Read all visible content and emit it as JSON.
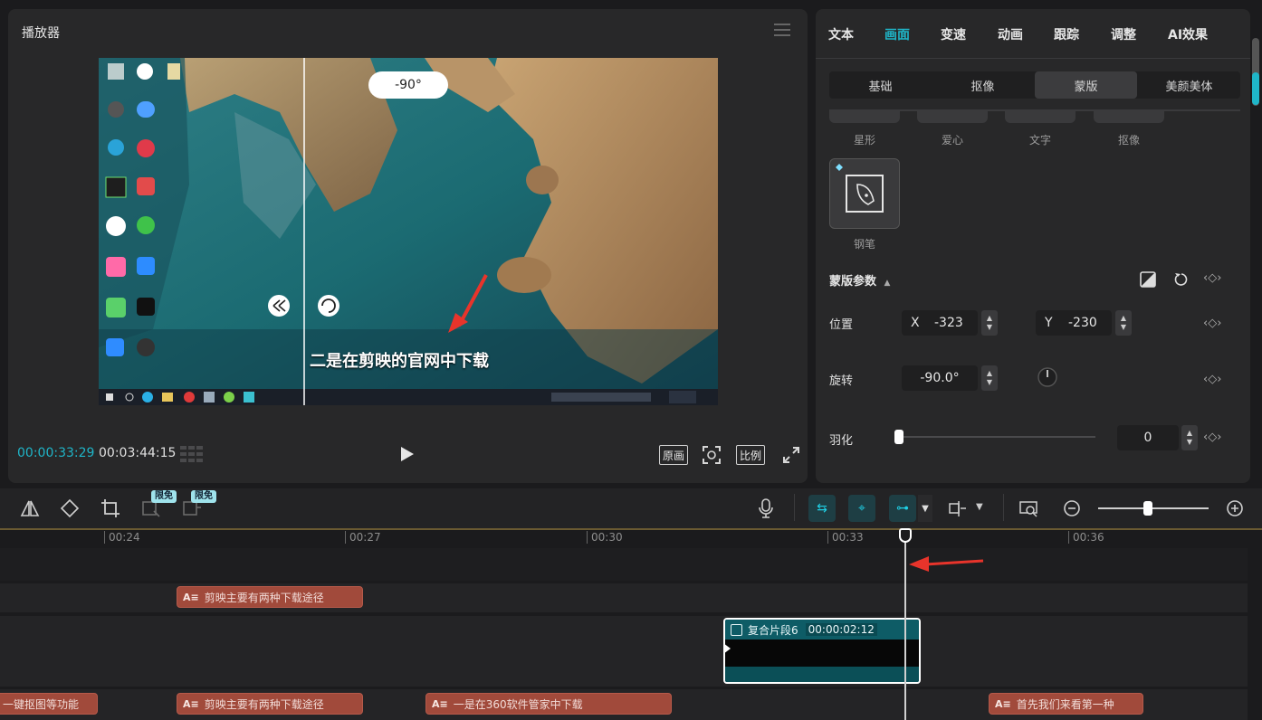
{
  "player": {
    "title": "播放器",
    "rotation_bubble": "-90°",
    "subtitle": "二是在剪映的官网中下载",
    "time_current": "00:00:33:29",
    "time_total": "00:03:44:15",
    "btn_original": "原画",
    "btn_ratio": "比例"
  },
  "props": {
    "tabs": [
      "文本",
      "画面",
      "变速",
      "动画",
      "跟踪",
      "调整",
      "AI效果"
    ],
    "active_tab": "画面",
    "subtabs": [
      "基础",
      "抠像",
      "蒙版",
      "美颜美体"
    ],
    "active_subtab": "蒙版",
    "shapes": [
      "星形",
      "爱心",
      "文字",
      "抠像"
    ],
    "pen_label": "钢笔",
    "mask_params_label": "蒙版参数",
    "position_label": "位置",
    "x_label": "X",
    "x_value": "-323",
    "y_label": "Y",
    "y_value": "-230",
    "rotation_label": "旋转",
    "rotation_value": "-90.0°",
    "feather_label": "羽化",
    "feather_value": "0",
    "feather_level": 0
  },
  "toolbar": {
    "badge1": "限免",
    "badge2": "限免"
  },
  "ruler": {
    "ticks": [
      "00:24",
      "00:27",
      "00:30",
      "00:33",
      "00:36"
    ]
  },
  "tracks": {
    "text_track1_clip": "剪映主要有两种下载途径",
    "compound_name": "复合片段6",
    "compound_duration": "00:00:02:12",
    "bottom_clips": [
      "一键抠图等功能",
      "剪映主要有两种下载途径",
      "一是在360软件管家中下载",
      "首先我们来看第一种"
    ],
    "text_badge": "A≡"
  },
  "colors": {
    "accent": "#1fb5c8",
    "text_clip": "#a14a3b",
    "compound": "#0d5a63",
    "annotation_arrow": "#e8342b"
  }
}
